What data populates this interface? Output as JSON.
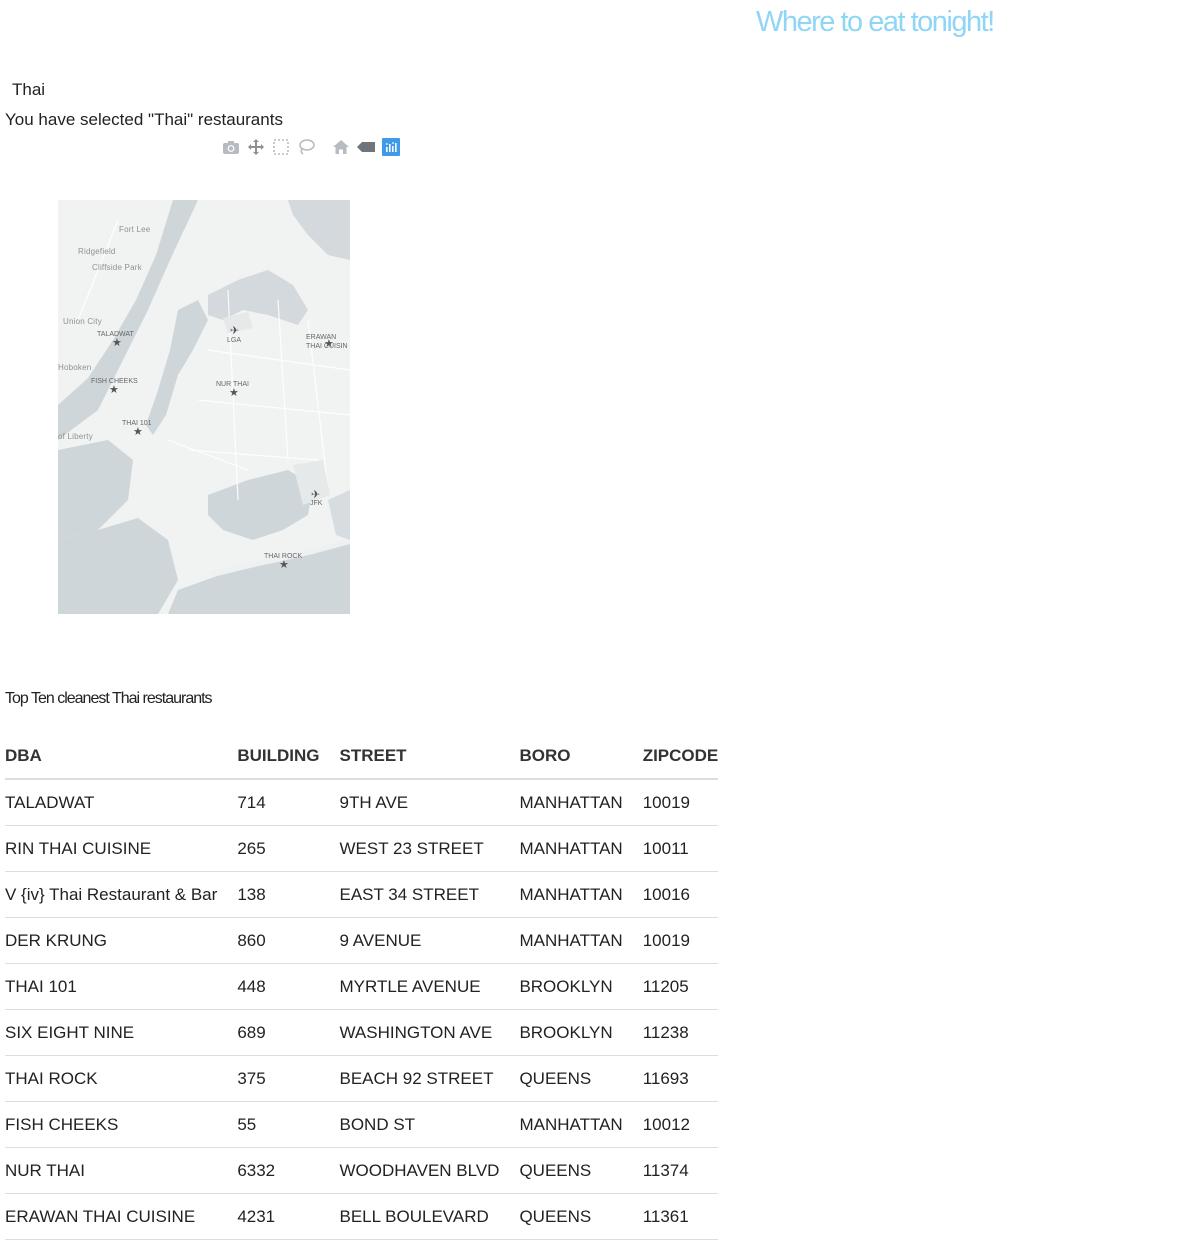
{
  "header": {
    "title": "Where to eat tonight!"
  },
  "filter": {
    "selected_cuisine": "Thai",
    "selection_message": "You have selected \"Thai\" restaurants"
  },
  "modebar": {
    "buttons": [
      {
        "name": "camera-icon",
        "active": false
      },
      {
        "name": "pan-icon",
        "active": false
      },
      {
        "name": "box-select-icon",
        "active": false
      },
      {
        "name": "lasso-select-icon",
        "active": false
      },
      {
        "name": "home-icon",
        "active": false
      },
      {
        "name": "tag-icon",
        "active": false
      },
      {
        "name": "plotly-logo-icon",
        "active": true
      }
    ],
    "accent_color": "#3d9be9"
  },
  "map": {
    "place_labels": [
      {
        "text": "Fort Lee"
      },
      {
        "text": "Ridgefield"
      },
      {
        "text": "Cliffside Park"
      },
      {
        "text": "Union City"
      },
      {
        "text": "Hoboken"
      },
      {
        "text": "of Liberty"
      },
      {
        "text": "LGA"
      },
      {
        "text": "JFK"
      }
    ],
    "restaurant_markers": [
      {
        "label": "TALADWAT"
      },
      {
        "label": "ERAWAN THAI CUISINE",
        "display": "ERAWAN\nTHAI CUISIN"
      },
      {
        "label": "FISH CHEEKS"
      },
      {
        "label": "NUR THAI"
      },
      {
        "label": "THAI 101"
      },
      {
        "label": "THAI ROCK"
      }
    ]
  },
  "table": {
    "caption": "Top Ten cleanest Thai restaurants",
    "columns": [
      "DBA",
      "BUILDING",
      "STREET",
      "BORO",
      "ZIPCODE"
    ],
    "rows": [
      [
        "TALADWAT",
        "714",
        "9TH AVE",
        "MANHATTAN",
        "10019"
      ],
      [
        "RIN THAI CUISINE",
        "265",
        "WEST 23 STREET",
        "MANHATTAN",
        "10011"
      ],
      [
        "V {iv} Thai Restaurant & Bar",
        "138",
        "EAST 34 STREET",
        "MANHATTAN",
        "10016"
      ],
      [
        "DER KRUNG",
        "860",
        "9 AVENUE",
        "MANHATTAN",
        "10019"
      ],
      [
        "THAI 101",
        "448",
        "MYRTLE AVENUE",
        "BROOKLYN",
        "11205"
      ],
      [
        "SIX EIGHT NINE",
        "689",
        "WASHINGTON AVE",
        "BROOKLYN",
        "11238"
      ],
      [
        "THAI ROCK",
        "375",
        "BEACH 92 STREET",
        "QUEENS",
        "11693"
      ],
      [
        "FISH CHEEKS",
        "55",
        "BOND ST",
        "MANHATTAN",
        "10012"
      ],
      [
        "NUR THAI",
        "6332",
        "WOODHAVEN BLVD",
        "QUEENS",
        "11374"
      ],
      [
        "ERAWAN THAI CUISINE",
        "4231",
        "BELL BOULEVARD",
        "QUEENS",
        "11361"
      ]
    ]
  }
}
